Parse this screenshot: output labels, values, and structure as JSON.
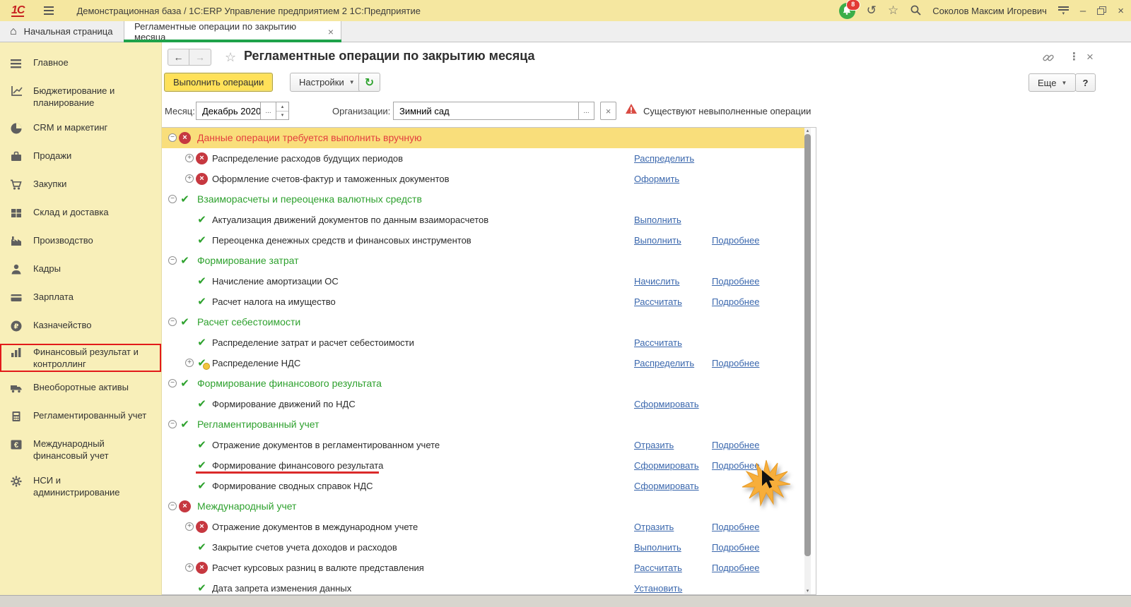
{
  "window": {
    "title": "Демонстрационная база / 1С:ERP Управление предприятием 2 1С:Предприятие",
    "logo": "1С",
    "user": "Соколов Максим Игоревич",
    "notification_count": "8"
  },
  "tabs": [
    {
      "label": "Начальная страница"
    },
    {
      "label": "Регламентные операции по закрытию месяца",
      "active": true
    }
  ],
  "sidebar": {
    "items": [
      {
        "label": "Главное",
        "icon": "menu-icon"
      },
      {
        "label": "Бюджетирование и планирование",
        "icon": "budgeting-icon"
      },
      {
        "label": "CRM и маркетинг",
        "icon": "crm-icon"
      },
      {
        "label": "Продажи",
        "icon": "sales-icon"
      },
      {
        "label": "Закупки",
        "icon": "purchases-icon"
      },
      {
        "label": "Склад и доставка",
        "icon": "warehouse-icon"
      },
      {
        "label": "Производство",
        "icon": "production-icon"
      },
      {
        "label": "Кадры",
        "icon": "hr-icon"
      },
      {
        "label": "Зарплата",
        "icon": "salary-icon"
      },
      {
        "label": "Казначейство",
        "icon": "treasury-icon"
      },
      {
        "label": "Финансовый результат и контроллинг",
        "icon": "finance-result-icon",
        "highlighted": true
      },
      {
        "label": "Внеоборотные активы",
        "icon": "assets-icon"
      },
      {
        "label": "Регламентированный учет",
        "icon": "regulated-accounting-icon"
      },
      {
        "label": "Международный финансовый учет",
        "icon": "intl-accounting-icon"
      },
      {
        "label": "НСИ и администрирование",
        "icon": "nsi-admin-icon"
      }
    ]
  },
  "page": {
    "title": "Регламентные операции по закрытию месяца",
    "toolbar": {
      "execute": "Выполнить операции",
      "settings": "Настройки",
      "more": "Еще",
      "help": "?"
    },
    "filters": {
      "month_label": "Месяц:",
      "month_value": "Декабрь 2020",
      "org_label": "Организации:",
      "org_value": "Зимний сад",
      "warning": "Существуют невыполненные операции"
    },
    "rows": [
      {
        "type": "group",
        "variant": "red",
        "status": "error",
        "collapse": true,
        "highlight": true,
        "text": "Данные операции требуется выполнить вручную"
      },
      {
        "type": "item",
        "status": "error",
        "expand": true,
        "text": "Распределение расходов будущих периодов",
        "action": "Распределить"
      },
      {
        "type": "item",
        "status": "error",
        "expand": true,
        "text": "Оформление счетов-фактур и таможенных документов",
        "action": "Оформить"
      },
      {
        "type": "group",
        "variant": "green",
        "status": "ok",
        "collapse": true,
        "text": "Взаиморасчеты и переоценка валютных средств"
      },
      {
        "type": "item",
        "status": "ok",
        "text": "Актуализация движений документов по данным взаиморасчетов",
        "action": "Выполнить"
      },
      {
        "type": "item",
        "status": "ok",
        "text": "Переоценка денежных средств и финансовых инструментов",
        "action": "Выполнить",
        "action2": "Подробнее"
      },
      {
        "type": "group",
        "variant": "green",
        "status": "ok",
        "collapse": true,
        "text": "Формирование затрат"
      },
      {
        "type": "item",
        "status": "ok",
        "text": "Начисление амортизации ОС",
        "action": "Начислить",
        "action2": "Подробнее"
      },
      {
        "type": "item",
        "status": "ok",
        "text": "Расчет налога на имущество",
        "action": "Рассчитать",
        "action2": "Подробнее"
      },
      {
        "type": "group",
        "variant": "green",
        "status": "ok",
        "collapse": true,
        "text": "Расчет себестоимости"
      },
      {
        "type": "item",
        "status": "ok",
        "text": "Распределение затрат и расчет себестоимости",
        "action": "Рассчитать"
      },
      {
        "type": "item",
        "status": "ok_warn",
        "expand": true,
        "text": "Распределение НДС",
        "action": "Распределить",
        "action2": "Подробнее"
      },
      {
        "type": "group",
        "variant": "green",
        "status": "ok",
        "collapse": true,
        "text": "Формирование финансового результата"
      },
      {
        "type": "item",
        "status": "ok",
        "text": "Формирование движений по НДС",
        "action": "Сформировать"
      },
      {
        "type": "group",
        "variant": "green",
        "status": "ok",
        "collapse": true,
        "text": "Регламентированный учет"
      },
      {
        "type": "item",
        "status": "ok",
        "text": "Отражение документов в регламентированном учете",
        "action": "Отразить",
        "action2": "Подробнее"
      },
      {
        "type": "item",
        "status": "ok",
        "text": "Формирование финансового результата",
        "action": "Сформировать",
        "action2": "Подробнее",
        "underlined": true
      },
      {
        "type": "item",
        "status": "ok",
        "text": "Формирование сводных справок НДС",
        "action": "Сформировать"
      },
      {
        "type": "group",
        "variant": "green",
        "status": "error",
        "collapse": true,
        "text": "Международный учет"
      },
      {
        "type": "item",
        "status": "error",
        "expand": true,
        "text": "Отражение документов в международном учете",
        "action": "Отразить",
        "action2": "Подробнее"
      },
      {
        "type": "item",
        "status": "ok",
        "text": "Закрытие счетов учета доходов и расходов",
        "action": "Выполнить",
        "action2": "Подробнее"
      },
      {
        "type": "item",
        "status": "error",
        "expand": true,
        "text": "Расчет курсовых разниц в валюте представления",
        "action": "Рассчитать",
        "action2": "Подробнее"
      },
      {
        "type": "item",
        "status": "ok",
        "text": "Дата запрета изменения данных",
        "action": "Установить",
        "clipped": true
      }
    ]
  }
}
